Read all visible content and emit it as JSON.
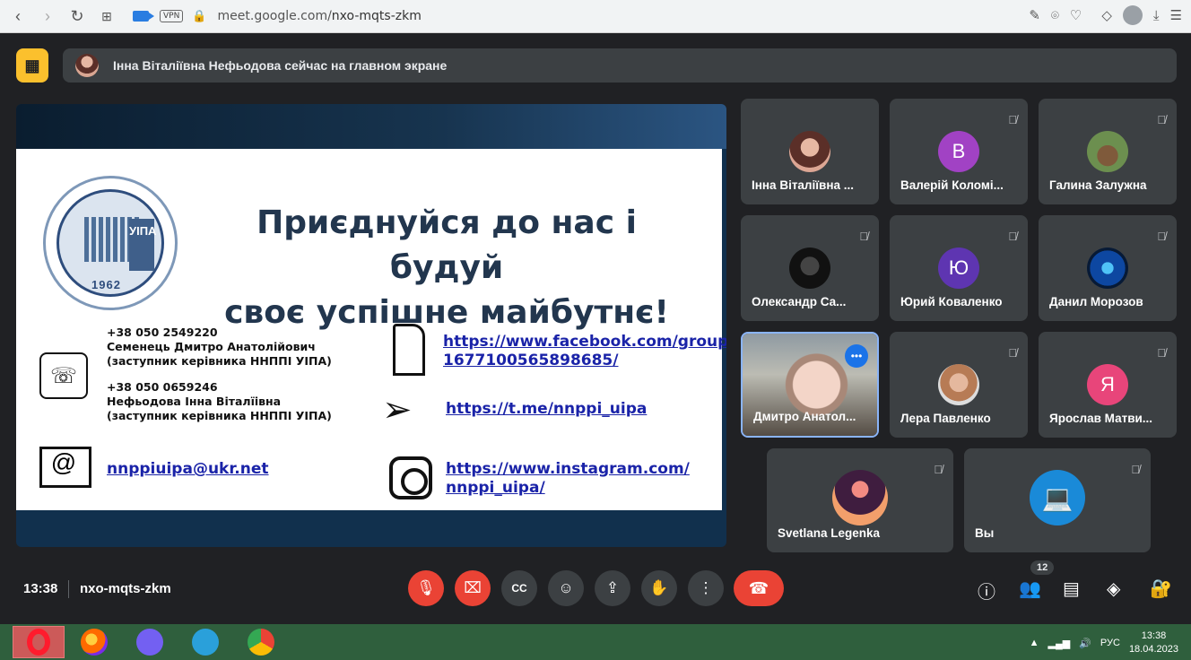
{
  "browser": {
    "url_prefix": "meet.google.com/",
    "url_path": "nxo-mqts-zkm",
    "vpn": "VPN"
  },
  "banner": {
    "text": "Інна Віталіївна Нефьодова сейчас на главном экране"
  },
  "slide": {
    "title_line1": "Приєднуйся до нас і будуй",
    "title_line2": "своє успішне майбутнє!",
    "logo_letters": "УІПА",
    "logo_year": "1962",
    "contact1_phone": "+38 050 2549220",
    "contact1_name": "Семенець Дмитро Анатолійович",
    "contact1_role": "(заступник керівника ННППІ УІПА)",
    "contact2_phone": "+38 050 0659246",
    "contact2_name": "Нефьодова Інна Віталїівна",
    "contact2_role": "(заступник керівника ННППІ УІПА)",
    "email": "nnppiuipa@ukr.net",
    "facebook_line1": "https://www.facebook.com/groups/",
    "facebook_line2": "1677100565898685/",
    "telegram": "https://t.me/nnppi_uipa",
    "instagram_line1": "https://www.instagram.com/",
    "instagram_line2": "nnppi_uipa/"
  },
  "participants": [
    {
      "name": "Інна Віталіївна ...",
      "initial": ""
    },
    {
      "name": "Валерій Коломі...",
      "initial": "В",
      "color": "#a142c4"
    },
    {
      "name": "Галина Залужна",
      "initial": ""
    },
    {
      "name": "Олександр Са...",
      "initial": ""
    },
    {
      "name": "Юрий Коваленко",
      "initial": "Ю",
      "color": "#5e35b1"
    },
    {
      "name": "Данил Морозов",
      "initial": ""
    },
    {
      "name": "Дмитро Анатол...",
      "initial": ""
    },
    {
      "name": "Лера Павленко",
      "initial": ""
    },
    {
      "name": "Ярослав Матви...",
      "initial": "Я",
      "color": "#e8457a"
    },
    {
      "name": "Svetlana Legenka",
      "initial": ""
    },
    {
      "name": "Вы",
      "initial": ""
    }
  ],
  "bottom": {
    "time": "13:38",
    "meeting_code": "nxo-mqts-zkm",
    "participant_count": "12"
  },
  "taskbar": {
    "lang": "РУС",
    "time": "13:38",
    "date": "18.04.2023"
  },
  "colors": {
    "meet_bg": "#202124",
    "tile_bg": "#3c4043",
    "danger": "#ea4335",
    "banner_button": "#fbc02d",
    "link": "#1a23a8",
    "taskbar": "#2f5f3d"
  }
}
